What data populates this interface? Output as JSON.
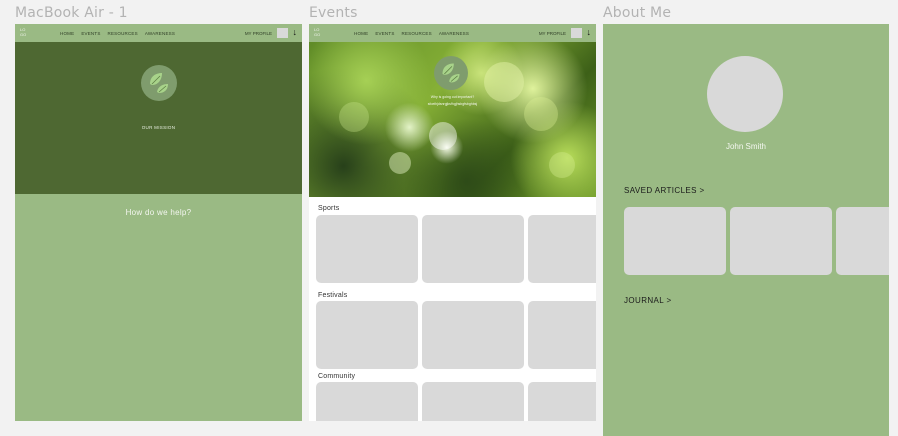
{
  "frames": {
    "f1_title": "MacBook Air - 1",
    "f2_title": "Events",
    "f3_title": "About Me"
  },
  "nav": {
    "logo": "LO GO",
    "links": [
      "HOME",
      "EVENTS",
      "RESOURCES",
      "AWARENESS"
    ],
    "profile": "MY PROFILE",
    "arrow": "↓"
  },
  "home": {
    "mission": "OUR MISSION",
    "help": "How do we help?"
  },
  "events": {
    "hero_line1": "Why is going out important?",
    "hero_line2": "sfoeihjdsnrgjksfhgjhsbgfsbghbsj",
    "sections": [
      "Sports",
      "Festivals",
      "Community"
    ]
  },
  "about": {
    "name": "John Smith",
    "saved": "SAVED ARTICLES >",
    "journal": "JOURNAL >"
  },
  "colors": {
    "sage": "#9aba84",
    "dark_green": "#4e6832",
    "card_gray": "#d9d9d9",
    "background": "#f2f2f2"
  }
}
